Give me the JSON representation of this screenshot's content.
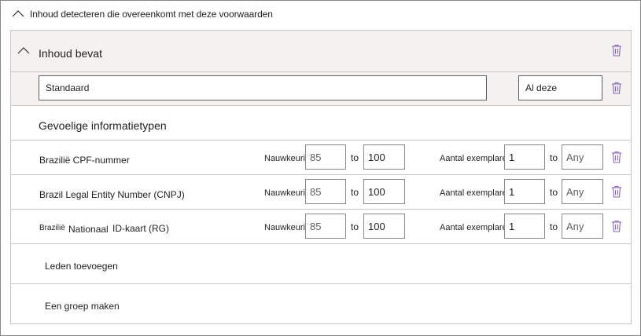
{
  "section": {
    "title": "Inhoud detecteren die overeenkomt met deze voorwaarden"
  },
  "group": {
    "title": "Inhoud bevat",
    "name_value": "Standaard",
    "operator_value": "Al deze",
    "sit_heading": "Gevoelige informatietypen"
  },
  "rows": [
    {
      "name": "Brazilië CPF-nummer",
      "accuracy_label": "Nauwkeurigheid",
      "accuracy_min": "85",
      "to1": "to",
      "accuracy_max": "100",
      "instances_label": "Aantal exemplaren",
      "instances_min": "1",
      "to2": "to",
      "instances_max": "Any"
    },
    {
      "name": "Brazil Legal Entity Number (CNPJ)",
      "accuracy_label": "Nauwkeurigheid",
      "accuracy_min": "85",
      "to1": "to",
      "accuracy_max": "100",
      "instances_label": "Aantal exemplaren",
      "instances_min": "1",
      "to2": "to",
      "instances_max": "Any"
    },
    {
      "name_part1": "Brazilië",
      "name_part2": "Nationaal",
      "name_part3": "ID-kaart (RG)",
      "accuracy_label": "Nauwkeurigheid",
      "accuracy_min": "85",
      "to1": "to",
      "accuracy_max": "100",
      "instances_label": "Aantal exemplaren",
      "instances_min": "1",
      "to2": "to",
      "instances_max": "Any"
    }
  ],
  "actions": {
    "add_members": "Leden toevoegen",
    "create_group": "Een groep maken"
  },
  "colors": {
    "trash": "#8764b8",
    "band": "#f3f2f1",
    "border": "#c8c6c4"
  },
  "icons": {
    "collapse": "chevron-up-icon",
    "delete": "trash-icon"
  }
}
